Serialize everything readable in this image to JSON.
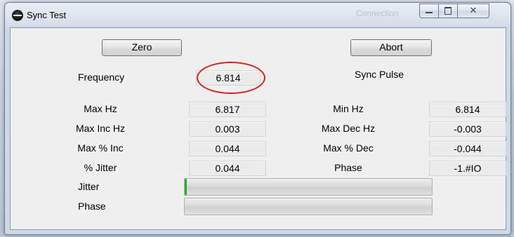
{
  "window": {
    "title": "Sync Test"
  },
  "background": {
    "ghost_text": "Connection"
  },
  "buttons": {
    "zero": "Zero",
    "abort": "Abort"
  },
  "frequency": {
    "label": "Frequency",
    "value": "6.814"
  },
  "sync_pulse": {
    "label": "Sync Pulse"
  },
  "stats_left": [
    {
      "label": "Max Hz",
      "value": "6.817"
    },
    {
      "label": "Max Inc Hz",
      "value": "0.003"
    },
    {
      "label": "Max % Inc",
      "value": "0.044"
    },
    {
      "label": "% Jitter",
      "value": "0.044"
    }
  ],
  "stats_right": [
    {
      "label": "Min Hz",
      "value": "6.814"
    },
    {
      "label": "Max Dec Hz",
      "value": "-0.003"
    },
    {
      "label": "Max % Dec",
      "value": "-0.044"
    },
    {
      "label": "Phase",
      "value": "-1.#IO"
    }
  ],
  "jitter_bar": {
    "label": "Jitter",
    "progress": 0.008,
    "color": "#21b721"
  },
  "phase_bar": {
    "label": "Phase",
    "progress": 0
  },
  "colors": {
    "annotation_ring": "#e21c1c"
  },
  "icons": {
    "app": "app-logo-icon",
    "minimize": "minimize-icon",
    "maximize": "maximize-icon",
    "close": "close-icon"
  }
}
